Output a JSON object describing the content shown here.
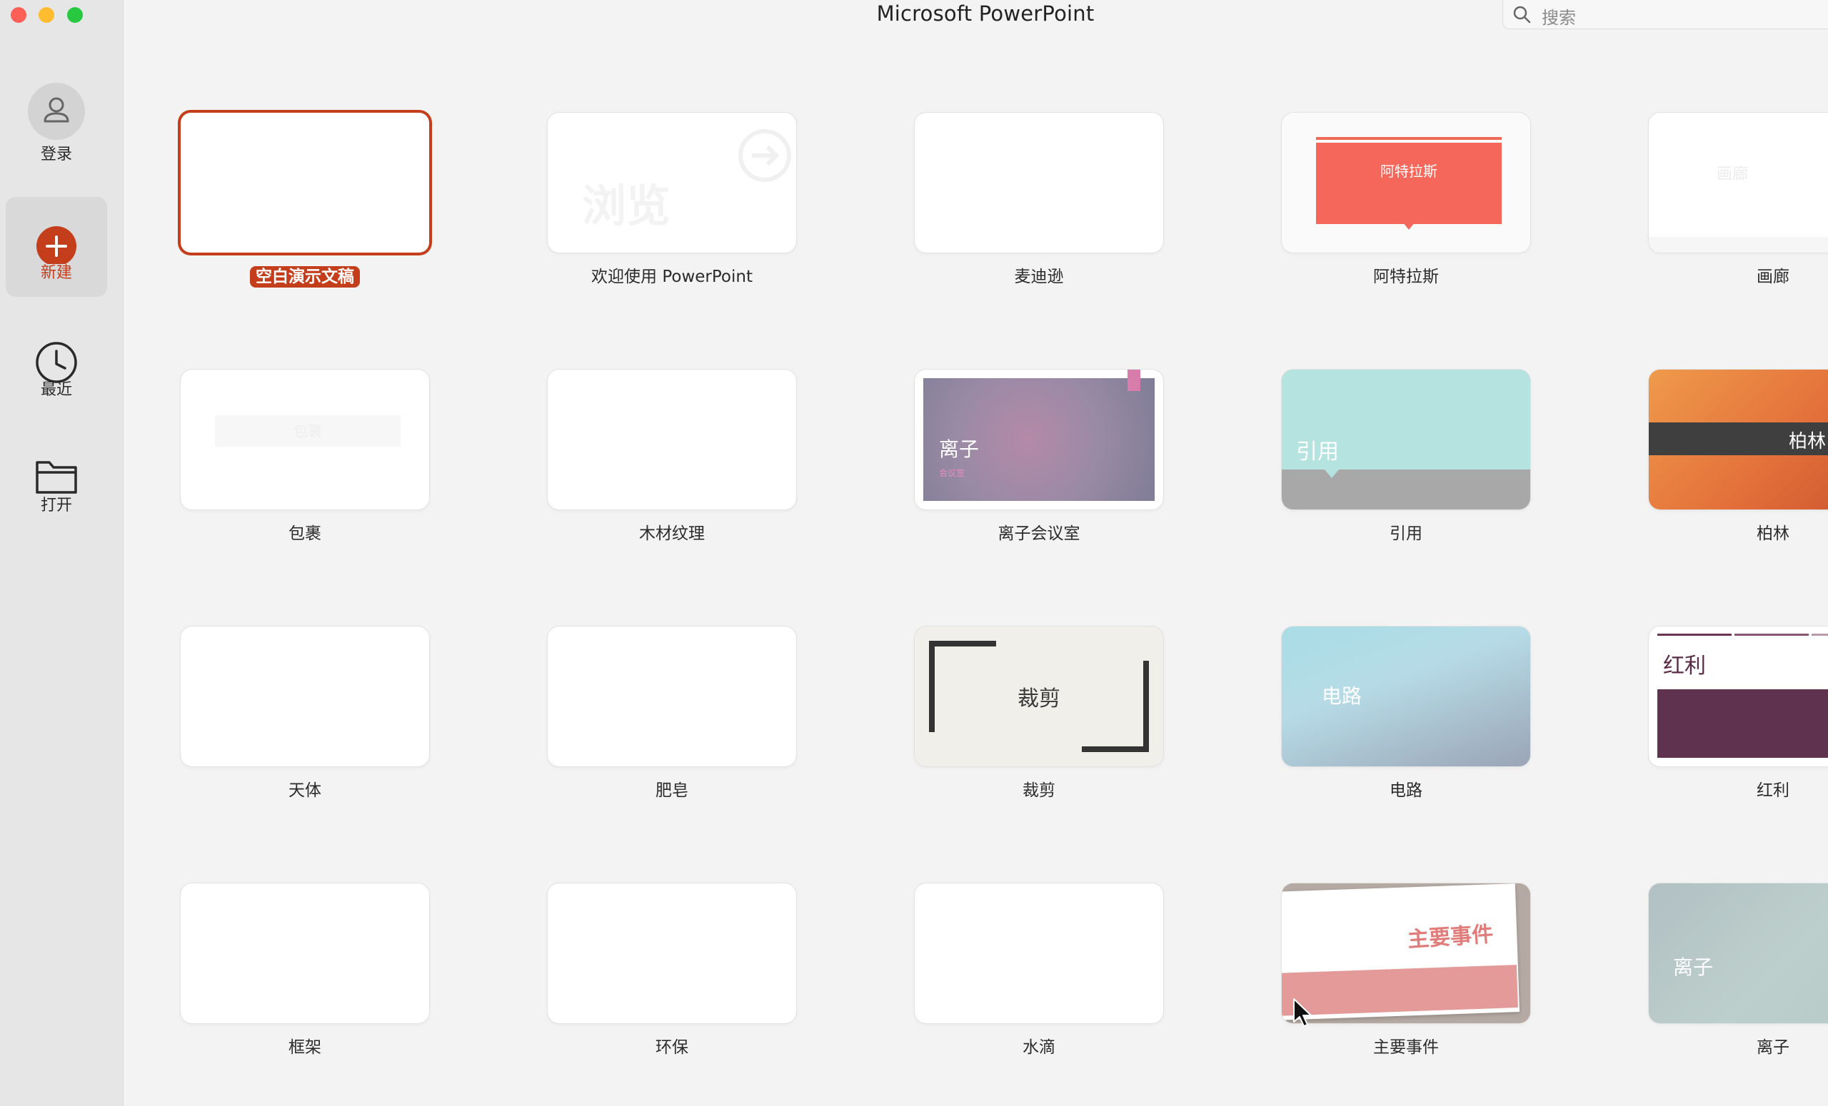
{
  "window": {
    "title": "Microsoft PowerPoint"
  },
  "search": {
    "placeholder": "搜索"
  },
  "sidebar": {
    "items": [
      {
        "label": "登录",
        "icon": "user-icon"
      },
      {
        "label": "新建",
        "icon": "plus-circle-icon"
      },
      {
        "label": "最近",
        "icon": "clock-icon"
      },
      {
        "label": "打开",
        "icon": "folder-icon"
      }
    ]
  },
  "templates": [
    {
      "label": "空白演示文稿",
      "selected": true
    },
    {
      "label": "欢迎使用 PowerPoint",
      "thumb_text": "浏览"
    },
    {
      "label": "麦迪逊"
    },
    {
      "label": "阿特拉斯",
      "thumb_text": "阿特拉斯"
    },
    {
      "label": "画廊",
      "thumb_text": "画廊"
    },
    {
      "label": "包裹",
      "thumb_text": "包裹"
    },
    {
      "label": "木材纹理"
    },
    {
      "label": "离子会议室",
      "thumb_text": "离子",
      "thumb_subtext": "会议室"
    },
    {
      "label": "引用",
      "thumb_text": "引用"
    },
    {
      "label": "柏林",
      "thumb_text": "柏林"
    },
    {
      "label": "天体"
    },
    {
      "label": "肥皂"
    },
    {
      "label": "裁剪",
      "thumb_text": "裁剪"
    },
    {
      "label": "电路",
      "thumb_text": "电路"
    },
    {
      "label": "红利",
      "thumb_text": "红利"
    },
    {
      "label": "框架"
    },
    {
      "label": "环保"
    },
    {
      "label": "水滴"
    },
    {
      "label": "主要事件",
      "thumb_text": "主要事件"
    },
    {
      "label": "离子",
      "thumb_text": "离子"
    }
  ],
  "colors": {
    "accent": "#c43e1c",
    "sidebar_bg": "#e6e6e6",
    "canvas_bg": "#f3f3f3"
  }
}
